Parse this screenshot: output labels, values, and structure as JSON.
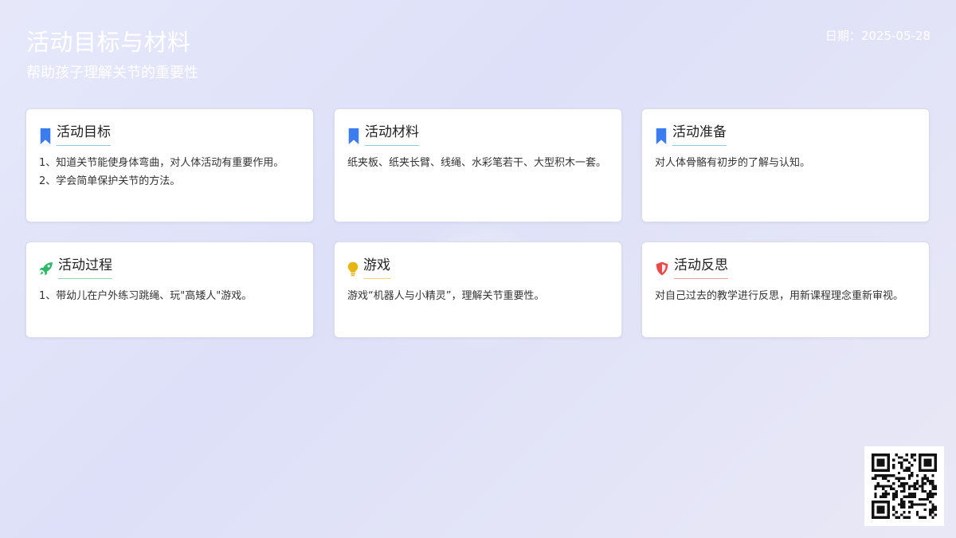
{
  "header": {
    "title": "活动目标与材料",
    "subtitle": "帮助孩子理解关节的重要性",
    "date": "日期：2025-05-28"
  },
  "cards": [
    {
      "title": "活动目标",
      "icon": "bookmark-icon",
      "icon_color": "#3b7cf0",
      "line_color": "#8fc6d8",
      "body": "1、知道关节能使身体弯曲，对人体活动有重要作用。\n2、学会简单保护关节的方法。"
    },
    {
      "title": "活动材料",
      "icon": "bookmark-icon",
      "icon_color": "#3b7cf0",
      "line_color": "#8fc6d8",
      "body": "纸夹板、纸夹长臂、线绳、水彩笔若干、大型积木一套。"
    },
    {
      "title": "活动准备",
      "icon": "bookmark-icon",
      "icon_color": "#3b7cf0",
      "line_color": "#8fc6d8",
      "body": "对人体骨骼有初步的了解与认知。"
    },
    {
      "title": "活动过程",
      "icon": "rocket-icon",
      "icon_color": "#2fb86a",
      "line_color": "#8fd8a8",
      "body": "1、带幼儿在户外练习跳绳、玩\"高矮人\"游戏。"
    },
    {
      "title": "游戏",
      "icon": "lightbulb-icon",
      "icon_color": "#e6b511",
      "line_color": "#f0d878",
      "body": "游戏“机器人与小精灵”，理解关节重要性。"
    },
    {
      "title": "活动反思",
      "icon": "shield-icon",
      "icon_color": "#e84a4a",
      "line_color": "#f0a0a0",
      "body": "对自己过去的教学进行反思，用新课程理念重新审视。"
    }
  ],
  "qr": {
    "icon": "qr-code"
  }
}
